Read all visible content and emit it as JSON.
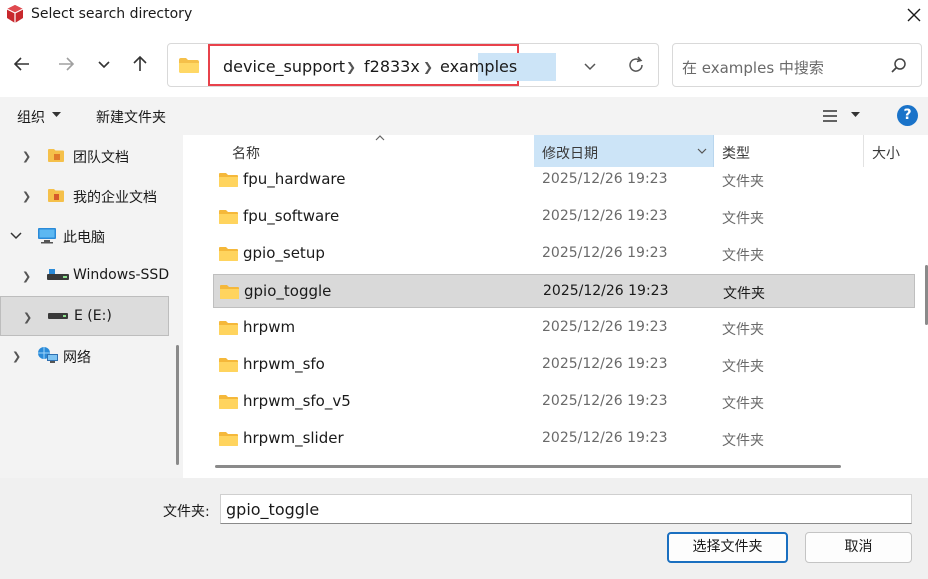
{
  "window": {
    "title": "Select search directory",
    "colors": {
      "accent": "#1a73c9",
      "highlight": "#cce4f7",
      "callout": "#e8424b"
    }
  },
  "nav": {
    "back": "back-arrow-icon",
    "forward": "forward-arrow-icon",
    "recent": "chevron-down-icon",
    "up": "up-arrow-icon",
    "breadcrumbs": [
      "device_support",
      "f2833x",
      "examples"
    ],
    "refresh": "refresh-icon"
  },
  "search": {
    "placeholder": "在 examples 中搜索"
  },
  "toolbar": {
    "organize": "组织",
    "new_folder": "新建文件夹",
    "help": "?"
  },
  "sidebar": {
    "items": [
      {
        "label": "团队文档"
      },
      {
        "label": "我的企业文档"
      },
      {
        "label": "此电脑"
      },
      {
        "label": "Windows-SSD"
      },
      {
        "label": "E (E:)"
      },
      {
        "label": "网络"
      }
    ]
  },
  "list": {
    "columns": [
      "名称",
      "修改日期",
      "类型",
      "大小"
    ],
    "rows": [
      {
        "name": "fpu_hardware",
        "date": "2025/12/26 19:23",
        "type": "文件夹"
      },
      {
        "name": "fpu_software",
        "date": "2025/12/26 19:23",
        "type": "文件夹"
      },
      {
        "name": "gpio_setup",
        "date": "2025/12/26 19:23",
        "type": "文件夹"
      },
      {
        "name": "gpio_toggle",
        "date": "2025/12/26 19:23",
        "type": "文件夹"
      },
      {
        "name": "hrpwm",
        "date": "2025/12/26 19:23",
        "type": "文件夹"
      },
      {
        "name": "hrpwm_sfo",
        "date": "2025/12/26 19:23",
        "type": "文件夹"
      },
      {
        "name": "hrpwm_sfo_v5",
        "date": "2025/12/26 19:23",
        "type": "文件夹"
      },
      {
        "name": "hrpwm_slider",
        "date": "2025/12/26 19:23",
        "type": "文件夹"
      }
    ]
  },
  "footer": {
    "folder_label": "文件夹:",
    "folder_value": "gpio_toggle",
    "select_button": "选择文件夹",
    "cancel_button": "取消"
  }
}
